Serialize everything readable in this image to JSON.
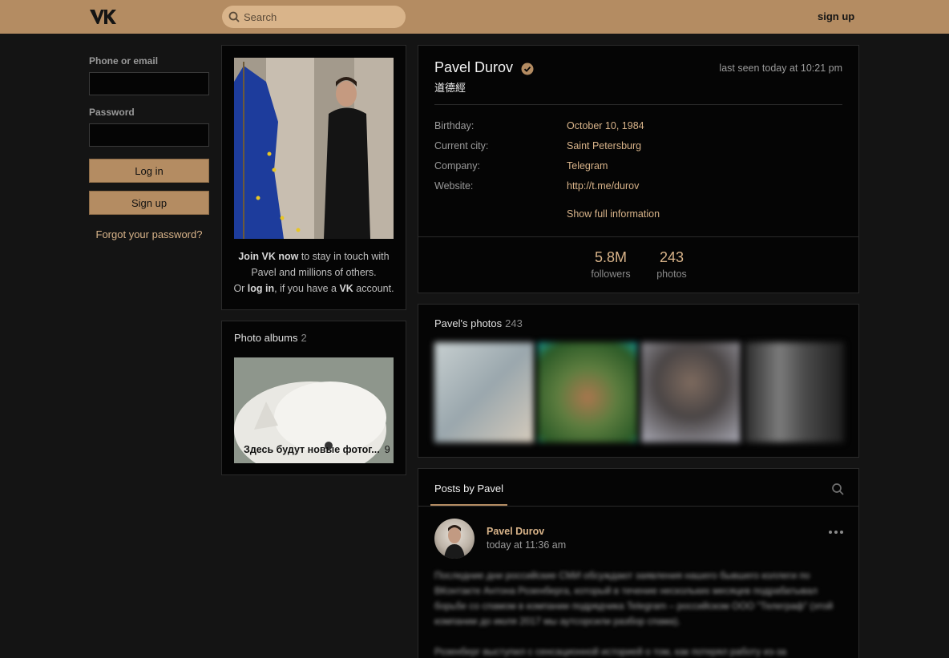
{
  "header": {
    "search_placeholder": "Search",
    "signup_label": "sign up"
  },
  "login": {
    "phone_label": "Phone or email",
    "password_label": "Password",
    "login_button": "Log in",
    "signup_button": "Sign up",
    "forgot_link": "Forgot your password?"
  },
  "avatar_card": {
    "join_bold": "Join VK now",
    "join_rest": " to stay in touch with Pavel and millions of others.",
    "or": "Or ",
    "login_link": "log in",
    "if_have": ", if you have a ",
    "vk": "VK",
    "account": " account."
  },
  "albums": {
    "title": "Photo albums",
    "count": "2",
    "album_title": "Здесь будут новые фотог...",
    "album_count": "9"
  },
  "profile": {
    "name": "Pavel Durov",
    "status": "道德經",
    "last_seen": "last seen today at 10:21 pm",
    "info": [
      {
        "key": "Birthday:",
        "value": "October 10, 1984"
      },
      {
        "key": "Current city:",
        "value": "Saint Petersburg"
      },
      {
        "key": "Company:",
        "value": "Telegram"
      },
      {
        "key": "Website:",
        "value": "http://t.me/durov"
      }
    ],
    "show_full": "Show full information",
    "counters": [
      {
        "num": "5.8M",
        "label": "followers"
      },
      {
        "num": "243",
        "label": "photos"
      }
    ]
  },
  "photos": {
    "title": "Pavel's photos",
    "count": "243"
  },
  "posts": {
    "tab_label": "Posts by Pavel",
    "author": "Pavel Durov",
    "time": "today at 11:36 am",
    "text": "Последние дни российские СМИ обсуждают заявления нашего бывшего коллеги по ВКонтакте Антона Розенберга, который в течение нескольких месяцев подрабатывал борьбе со спамом в компании подрядчика Telegram – российском ООО \"Телеграф\" (этой компании до июля 2017 мы аутсорсили разбор спама).",
    "text2": "Розенберг выступил с сенсационной историей о том, как потерял работу из-за"
  },
  "colors": {
    "accent": "#b48c62",
    "link": "#d9b48a",
    "background": "#141414",
    "card": "#050505"
  },
  "icons": [
    "vk-logo-icon",
    "search-icon",
    "verified-icon",
    "more-dots-icon"
  ]
}
